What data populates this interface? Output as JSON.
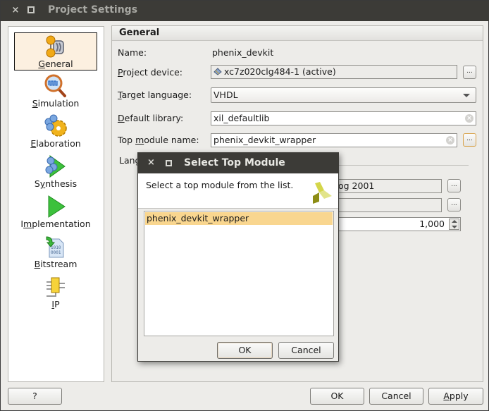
{
  "window": {
    "title": "Project Settings",
    "close_glyph": "×"
  },
  "sidebar": {
    "items": [
      {
        "label": "General",
        "mnemonic": "G",
        "rest": "eneral",
        "icon": "general-icon",
        "selected": true
      },
      {
        "label": "Simulation",
        "mnemonic": "S",
        "rest": "imulation",
        "icon": "simulation-icon",
        "selected": false
      },
      {
        "label": "Elaboration",
        "mnemonic": "E",
        "rest": "laboration",
        "icon": "elaboration-icon",
        "selected": false
      },
      {
        "label": "Synthesis",
        "pre": "S",
        "mnemonic": "y",
        "rest": "nthesis",
        "icon": "synthesis-icon",
        "selected": false
      },
      {
        "label": "Implementation",
        "pre": "I",
        "mnemonic": "m",
        "rest": "plementation",
        "icon": "implementation-icon",
        "selected": false
      },
      {
        "label": "Bitstream",
        "mnemonic": "B",
        "rest": "itstream",
        "icon": "bitstream-icon",
        "selected": false
      },
      {
        "label": "IP",
        "mnemonic": "I",
        "rest": "P",
        "icon": "ip-icon",
        "selected": false
      }
    ]
  },
  "panel": {
    "header": "General",
    "name_label": "Name:",
    "name_value": "phenix_devkit",
    "device_label_m": "P",
    "device_label_rest": "roject device:",
    "device_value": "xc7z020clg484-1 (active)",
    "language_label_m": "T",
    "language_label_rest": "arget language:",
    "language_value": "VHDL",
    "library_label_m": "D",
    "library_label_rest": "efault library:",
    "library_value": "xil_defaultlib",
    "top_label_pre": "Top ",
    "top_label_m": "m",
    "top_label_rest": "odule name:",
    "top_value": "phenix_devkit_wrapper",
    "lang_section_partial": "Lang",
    "verilog_partial": "og 2001",
    "empty_field": "",
    "spinner_value": "1,000",
    "ellipsis": "..."
  },
  "footer": {
    "help": "?",
    "ok": "OK",
    "cancel": "Cancel",
    "apply_m": "A",
    "apply_rest": "pply"
  },
  "modal": {
    "title": "Select Top Module",
    "message": "Select a top module from the list.",
    "items": [
      "phenix_devkit_wrapper"
    ],
    "ok": "OK",
    "cancel": "Cancel"
  }
}
